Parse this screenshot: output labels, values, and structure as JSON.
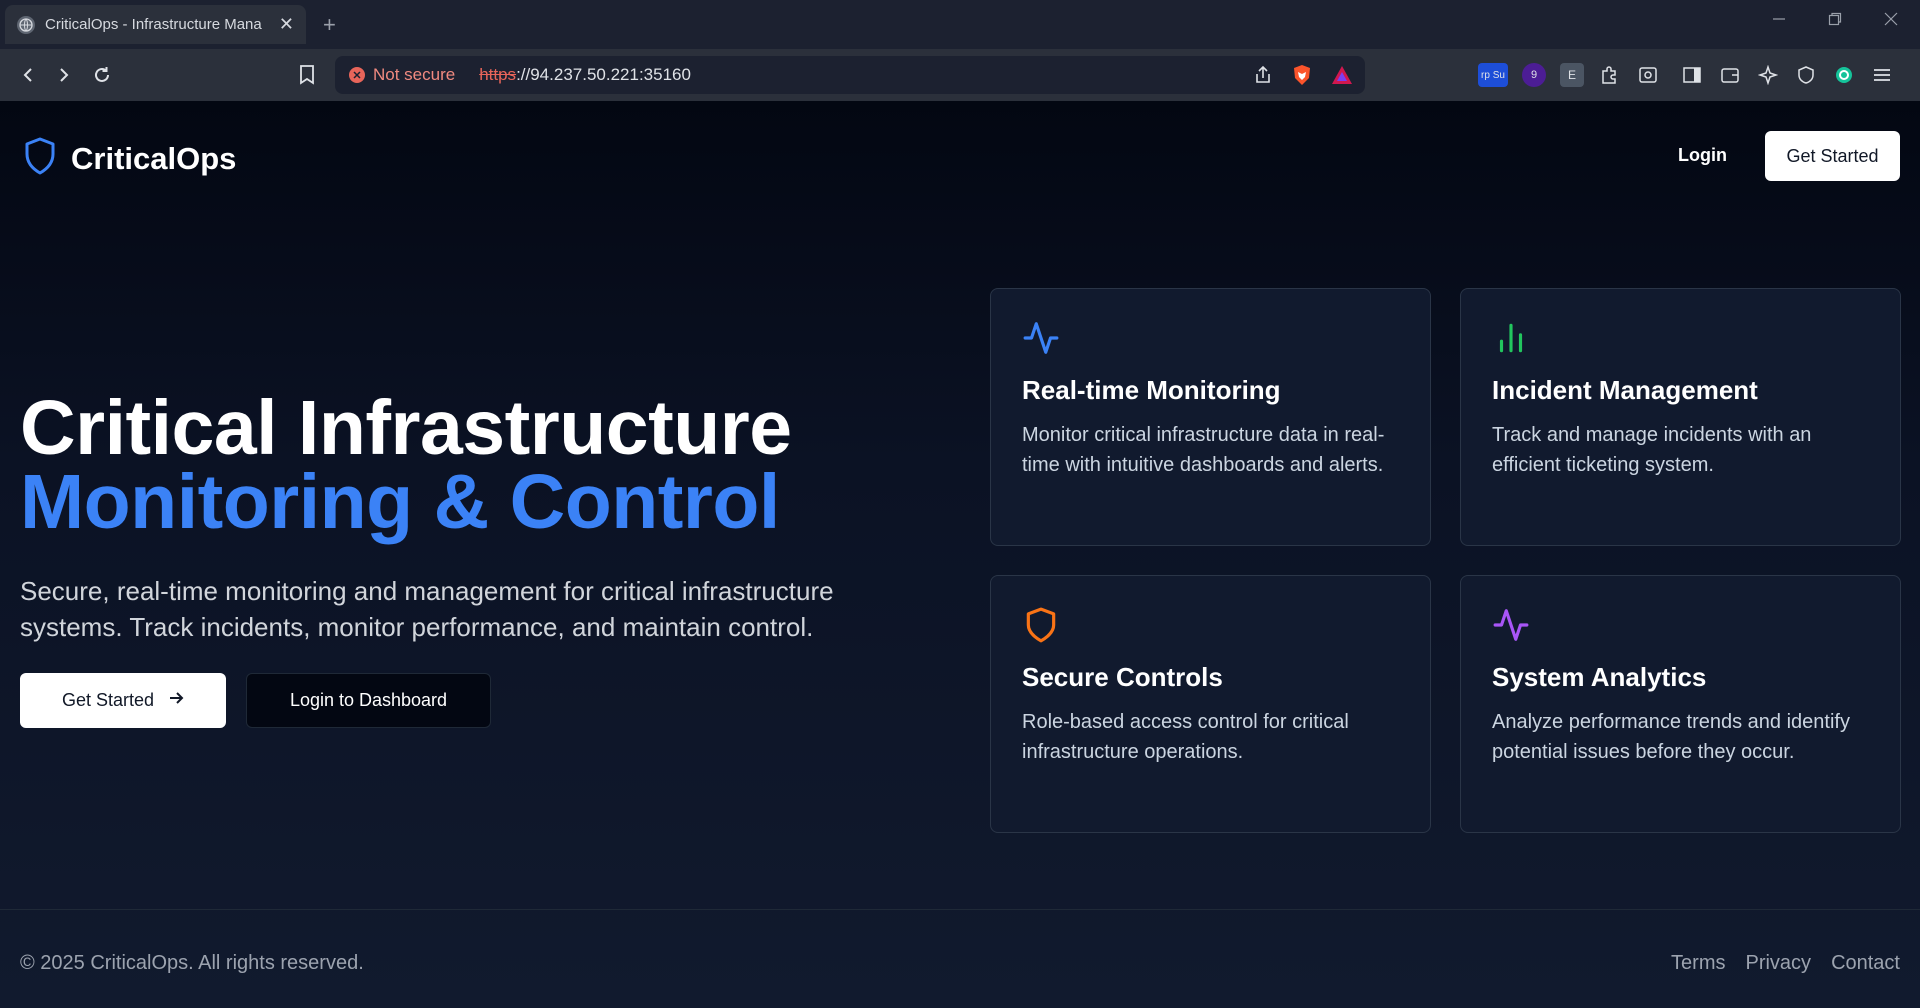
{
  "browser": {
    "tab_title": "CriticalOps - Infrastructure Mana",
    "tab_close": "✕",
    "new_tab": "+",
    "not_secure": "Not secure",
    "url_scheme": "https",
    "url_rest": "://94.237.50.221:35160",
    "ext_badge_1": "rp Su",
    "ext_badge_2": "9",
    "ext_badge_3": "E"
  },
  "nav": {
    "brand": "CriticalOps",
    "login": "Login",
    "get_started": "Get Started"
  },
  "hero": {
    "title_line1": "Critical Infrastructure",
    "title_line2": "Monitoring & Control",
    "subtitle": "Secure, real-time monitoring and management for critical infrastructure systems. Track incidents, monitor performance, and maintain control.",
    "primary_button": "Get Started",
    "secondary_button": "Login to Dashboard"
  },
  "features": [
    {
      "icon": "activity-icon",
      "color": "#3b82f6",
      "title": "Real-time Monitoring",
      "description": "Monitor critical infrastructure data in real-time with intuitive dashboards and alerts."
    },
    {
      "icon": "bar-chart-icon",
      "color": "#22c55e",
      "title": "Incident Management",
      "description": "Track and manage incidents with an efficient ticketing system."
    },
    {
      "icon": "shield-icon",
      "color": "#f97316",
      "title": "Secure Controls",
      "description": "Role-based access control for critical infrastructure operations."
    },
    {
      "icon": "activity-icon",
      "color": "#a855f7",
      "title": "System Analytics",
      "description": "Analyze performance trends and identify potential issues before they occur."
    }
  ],
  "footer": {
    "copyright": "© 2025 CriticalOps. All rights reserved.",
    "links": [
      "Terms",
      "Privacy",
      "Contact"
    ]
  },
  "colors": {
    "accent": "#3b82f6",
    "background": "#0b1120"
  }
}
